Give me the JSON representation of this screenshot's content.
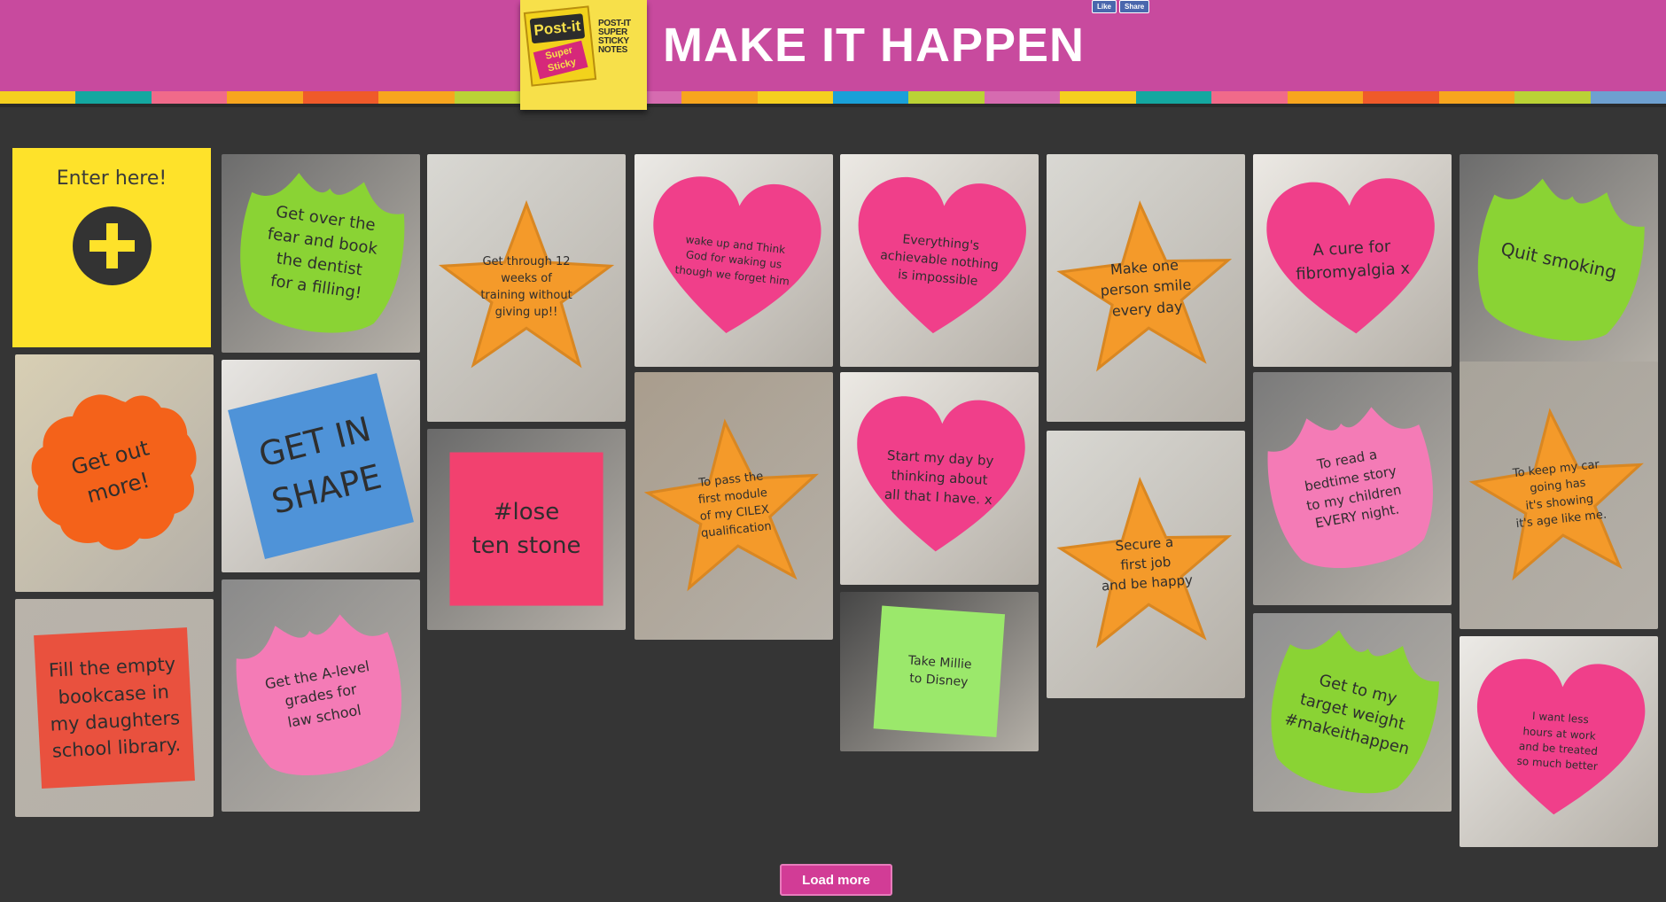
{
  "header": {
    "title": "MAKE IT HAPPEN",
    "logo_text": "Post-it",
    "logo_sub": "Super Sticky",
    "logo_tagline": "POST-IT SUPER STICKY NOTES",
    "like_label": "Like",
    "share_label": "Share"
  },
  "enter": {
    "label": "Enter here!"
  },
  "notes": [
    {
      "text": "Get over the\nfear and book\nthe dentist\nfor a filling!",
      "shape": "tulip",
      "color": "#8ad334"
    },
    {
      "text": "Get through 12\nweeks of\ntraining without\ngiving up!!",
      "shape": "star",
      "color": "#f49a2a"
    },
    {
      "text": "wake up and Think\nGod for waking us\nthough we forget him",
      "shape": "heart",
      "color": "#f03f8a"
    },
    {
      "text": "Everything's\nachievable nothing\nis impossible",
      "shape": "heart",
      "color": "#f03f8a"
    },
    {
      "text": "Make one\nperson smile\nevery day",
      "shape": "star",
      "color": "#f49a2a"
    },
    {
      "text": "A cure for\nfibromyalgia x",
      "shape": "heart",
      "color": "#f03f8a"
    },
    {
      "text": "Quit smoking",
      "shape": "tulip",
      "color": "#8ad334"
    },
    {
      "text": "Get out\nmore!",
      "shape": "flower",
      "color": "#f4621a"
    },
    {
      "text": "GET IN\nSHAPE",
      "shape": "square",
      "color": "#4f93d8"
    },
    {
      "text": "#lose\nten stone",
      "shape": "square",
      "color": "#f2416f"
    },
    {
      "text": "To pass the\nfirst module\nof my CILEX\nqualification",
      "shape": "star",
      "color": "#f49a2a"
    },
    {
      "text": "Start my day by\nthinking about\nall that I have. x",
      "shape": "heart",
      "color": "#f03f8a"
    },
    {
      "text": "Secure a\nfirst job\nand be happy",
      "shape": "star",
      "color": "#f49a2a"
    },
    {
      "text": "To read a\nbedtime story\nto my children\nEVERY night.",
      "shape": "tulip",
      "color": "#f47bb6"
    },
    {
      "text": "To keep my car\ngoing has\nit's showing\nit's age like me.",
      "shape": "star",
      "color": "#f49a2a"
    },
    {
      "text": "Fill the empty\nbookcase in\nmy daughters\nschool library.",
      "shape": "square",
      "color": "#e9513e"
    },
    {
      "text": "Get the A-level\ngrades for\nlaw school",
      "shape": "tulip",
      "color": "#f47bb6"
    },
    {
      "text": "Take Millie\nto Disney",
      "shape": "square",
      "color": "#9be86b"
    },
    {
      "text": "Get to my\ntarget weight\n#makeithappen",
      "shape": "tulip",
      "color": "#8ad334"
    },
    {
      "text": "I want less\nhours at work\nand be treated\nso much better",
      "shape": "heart",
      "color": "#f03f8a"
    }
  ],
  "load_more": "Load more"
}
